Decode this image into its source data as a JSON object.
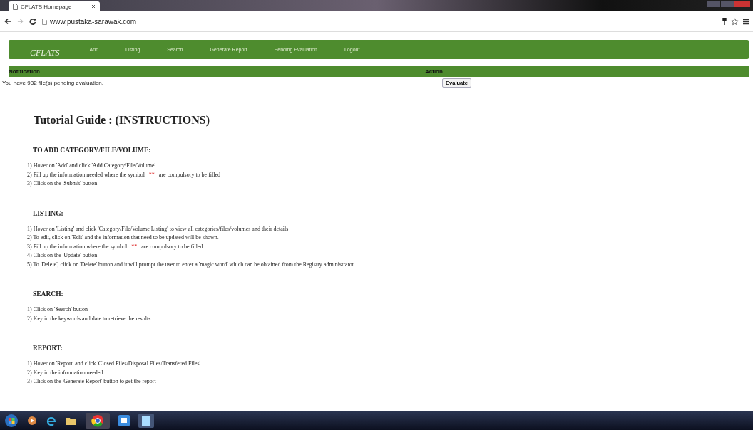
{
  "browser": {
    "tab_title": "CFLATS Homepage",
    "url": "www.pustaka-sarawak.com"
  },
  "nav": {
    "logo": "CFLATS",
    "items": [
      {
        "label": "Add"
      },
      {
        "label": "Listing"
      },
      {
        "label": "Search"
      },
      {
        "label": "Generate Report"
      },
      {
        "label": "Pending Evaluation"
      },
      {
        "label": "Logout"
      }
    ]
  },
  "notification": {
    "header": "Notification",
    "action_header": "Action",
    "message": "You have 932 file(s) pending evaluation.",
    "button": "Evaluate"
  },
  "guide": {
    "title": "Tutorial Guide : (INSTRUCTIONS)",
    "sections": [
      {
        "heading": "TO ADD CATEGORY/FILE/VOLUME:",
        "items": [
          {
            "parts": [
              {
                "kind": "plain",
                "text": "1) Hover on 'Add' and click 'Add Category/File/Volume'"
              }
            ]
          },
          {
            "parts": [
              {
                "kind": "plain",
                "text": "2) Fill up the information needed where the symbol"
              },
              {
                "kind": "required",
                "text": "**"
              },
              {
                "kind": "plain",
                "text": "are compulsory to be filled"
              }
            ]
          },
          {
            "parts": [
              {
                "kind": "plain",
                "text": "3) Click on the 'Submit' button"
              }
            ]
          }
        ]
      },
      {
        "heading": "LISTING:",
        "items": [
          {
            "parts": [
              {
                "kind": "plain",
                "text": "1) Hover on 'Listing' and click 'Category/File/Volume Listing' to view all categories/files/volumes and their details"
              }
            ]
          },
          {
            "parts": [
              {
                "kind": "plain",
                "text": "2) To edit, click on 'Edit' and the information that need to be updated will be shown."
              }
            ]
          },
          {
            "parts": [
              {
                "kind": "plain",
                "text": "3) Fill up the information where the symbol"
              },
              {
                "kind": "required",
                "text": "**"
              },
              {
                "kind": "plain",
                "text": "are compulsory to be filled"
              }
            ]
          },
          {
            "parts": [
              {
                "kind": "plain",
                "text": "4) Click on the 'Update' button"
              }
            ]
          },
          {
            "parts": [
              {
                "kind": "plain",
                "text": "5) To 'Delete', click on 'Delete' button and it will prompt the user to enter a 'magic word' which can be obtained from the Registry administrator"
              }
            ]
          }
        ]
      },
      {
        "heading": "SEARCH:",
        "items": [
          {
            "parts": [
              {
                "kind": "plain",
                "text": "1) Click on 'Search' button"
              }
            ]
          },
          {
            "parts": [
              {
                "kind": "plain",
                "text": "2) Key in the keywords and date to retrieve the results"
              }
            ]
          }
        ]
      },
      {
        "heading": "REPORT:",
        "items": [
          {
            "parts": [
              {
                "kind": "plain",
                "text": "1) Hover on 'Report' and click 'Closed Files/Disposal Files/Transfered Files'"
              }
            ]
          },
          {
            "parts": [
              {
                "kind": "plain",
                "text": "2) Key in the information needed"
              }
            ]
          },
          {
            "parts": [
              {
                "kind": "plain",
                "text": "3) Click on the 'Generate Report' button to get the report"
              }
            ]
          }
        ]
      }
    ]
  }
}
